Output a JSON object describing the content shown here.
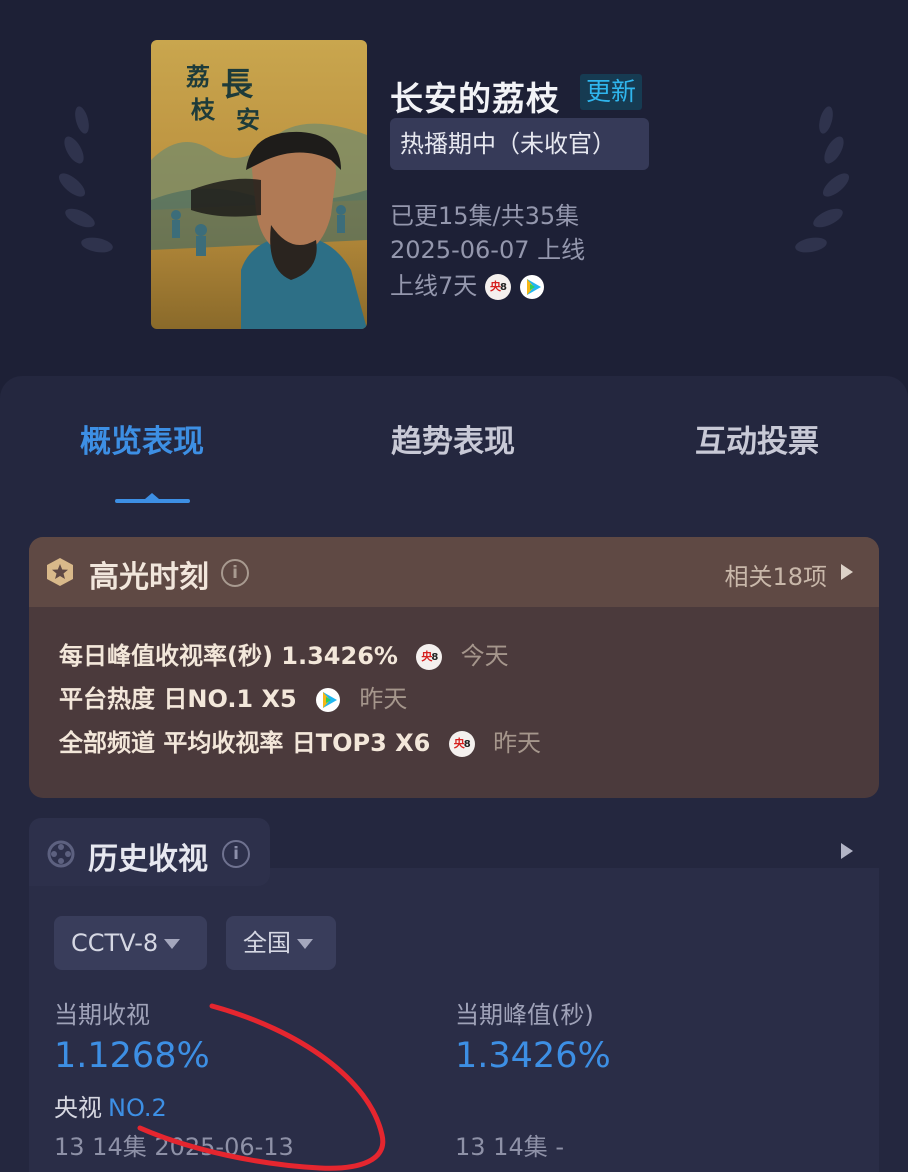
{
  "header": {
    "title": "长安的荔枝",
    "update_badge": "更新",
    "status": "热播期中（未收官）",
    "episodes": "已更15集/共35集",
    "release": "2025-06-07 上线",
    "online_days": "上线7天",
    "channel_badge": "央8",
    "poster_title_art": "長安的荔枝"
  },
  "tabs": [
    {
      "label": "概览表现",
      "active": true
    },
    {
      "label": "趋势表现",
      "active": false
    },
    {
      "label": "互动投票",
      "active": false
    }
  ],
  "highlights": {
    "title": "高光时刻",
    "related": "相关18项",
    "rows": [
      {
        "text": "每日峰值收视率(秒) 1.3426%",
        "source_icon": "cctv8-badge",
        "when": "今天"
      },
      {
        "text": "平台热度 日NO.1 X5",
        "source_icon": "tencent-video-icon",
        "when": "昨天"
      },
      {
        "text": "全部频道 平均收视率 日TOP3 X6",
        "source_icon": "cctv8-badge",
        "when": "昨天"
      }
    ]
  },
  "history": {
    "title": "历史收视",
    "channel_dropdown": "CCTV-8",
    "region_dropdown": "全国",
    "current_label": "当期收视",
    "current_value": "1.1268%",
    "rank_prefix": "央视",
    "rank_value": "NO.2",
    "current_sub": "13 14集 2025-06-13",
    "peak_label": "当期峰值(秒)",
    "peak_value": "1.3426%",
    "peak_sub": "13 14集 -"
  },
  "colors": {
    "accent": "#3d8fe4",
    "background": "#1d2036",
    "highlight_card": "#4b3a3c",
    "annotation": "#e5262f"
  }
}
